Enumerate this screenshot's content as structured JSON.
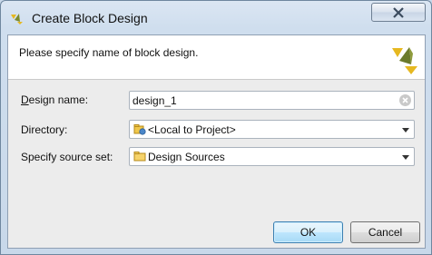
{
  "window": {
    "title": "Create Block Design",
    "close_label": "✕"
  },
  "header": {
    "message": "Please specify name of block design."
  },
  "form": {
    "design_name": {
      "label_accel": "D",
      "label_rest": "esign name:",
      "value": "design_1"
    },
    "directory": {
      "label_accel": "",
      "label_rest": "Directory:",
      "value": "<Local to Project>",
      "icon": "local-project-icon"
    },
    "source_set": {
      "label_accel": "",
      "label_rest": "Specify source set:",
      "value": "Design Sources",
      "icon": "folder-icon"
    }
  },
  "buttons": {
    "ok": "OK",
    "cancel": "Cancel"
  },
  "colors": {
    "logo_yellow": "#e6b820",
    "logo_dark": "#5f6b2a",
    "ok_border": "#3c7fb1"
  }
}
